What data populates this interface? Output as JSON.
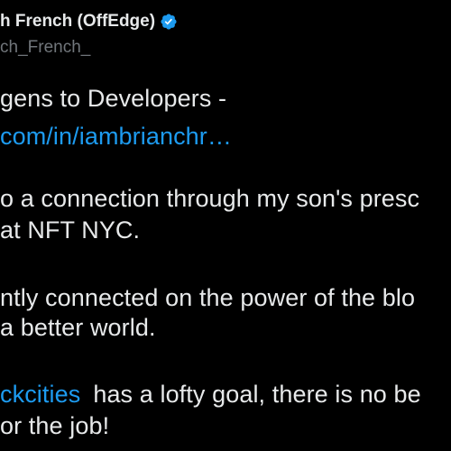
{
  "author": {
    "display_name": "h French (OffEdge)",
    "handle": "ch_French_"
  },
  "colors": {
    "background": "#000000",
    "text": "#e7e9ea",
    "secondary": "#71767b",
    "accent": "#1d9bf0"
  },
  "icons": {
    "verified": "verified-badge-icon"
  },
  "body": {
    "line1": "gens to Developers -",
    "line2_link": "com/in/iambrianchr…",
    "line3": "o a connection through my son's presc",
    "line4": "at NFT NYC.",
    "line5": "ntly connected on the power of the blo",
    "line6": "a better world.",
    "line7_mention": "ckcities",
    "line7_rest": "has a lofty goal, there is no be",
    "line8": "or the job!"
  }
}
